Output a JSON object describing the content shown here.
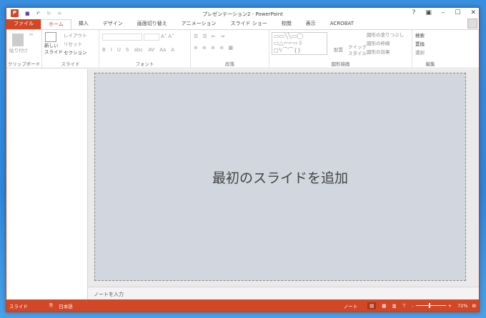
{
  "window": {
    "title": "プレゼンテーション2 - PowerPoint",
    "help": "?",
    "restore": "▣",
    "minimize": "–",
    "maximize": "☐",
    "close": "✕"
  },
  "quick_access": {
    "logo": "P",
    "save": "💾",
    "undo": "↶",
    "redo": "↻",
    "customize": "="
  },
  "tabs": [
    "ファイル",
    "ホーム",
    "挿入",
    "デザイン",
    "画面切り替え",
    "アニメーション",
    "スライド ショー",
    "校閲",
    "表示",
    "ACROBAT"
  ],
  "ribbon": {
    "clipboard": {
      "paste": "貼り付け",
      "label": "クリップボード"
    },
    "slides": {
      "new_slide": "新しい",
      "new_slide2": "スライド",
      "layout": "レイアウト",
      "reset": "リセット",
      "section": "セクション",
      "label": "スライド"
    },
    "font": {
      "bold": "B",
      "italic": "I",
      "underline": "U",
      "strike": "S",
      "abc": "abc",
      "spacing": "AV",
      "case": "Aa",
      "color": "A",
      "grow": "A˄",
      "shrink": "A˅",
      "label": "フォント"
    },
    "paragraph": {
      "label": "段落"
    },
    "drawing": {
      "arrange": "配置",
      "quick_style": "クイック",
      "quick_style2": "スタイル",
      "fill": "図形の塗りつぶし",
      "outline": "図形の枠線",
      "effect": "図形の効果",
      "label": "図形描画"
    },
    "editing": {
      "find": "検索",
      "replace": "置換",
      "select": "選択",
      "label": "編集"
    }
  },
  "slide": {
    "placeholder": "最初のスライドを追加"
  },
  "notes": {
    "placeholder": "ノートを入力"
  },
  "status": {
    "slide": "スライド",
    "language": "日本語",
    "notes": "ノート",
    "zoom": "72%",
    "zoom_value": 72
  }
}
